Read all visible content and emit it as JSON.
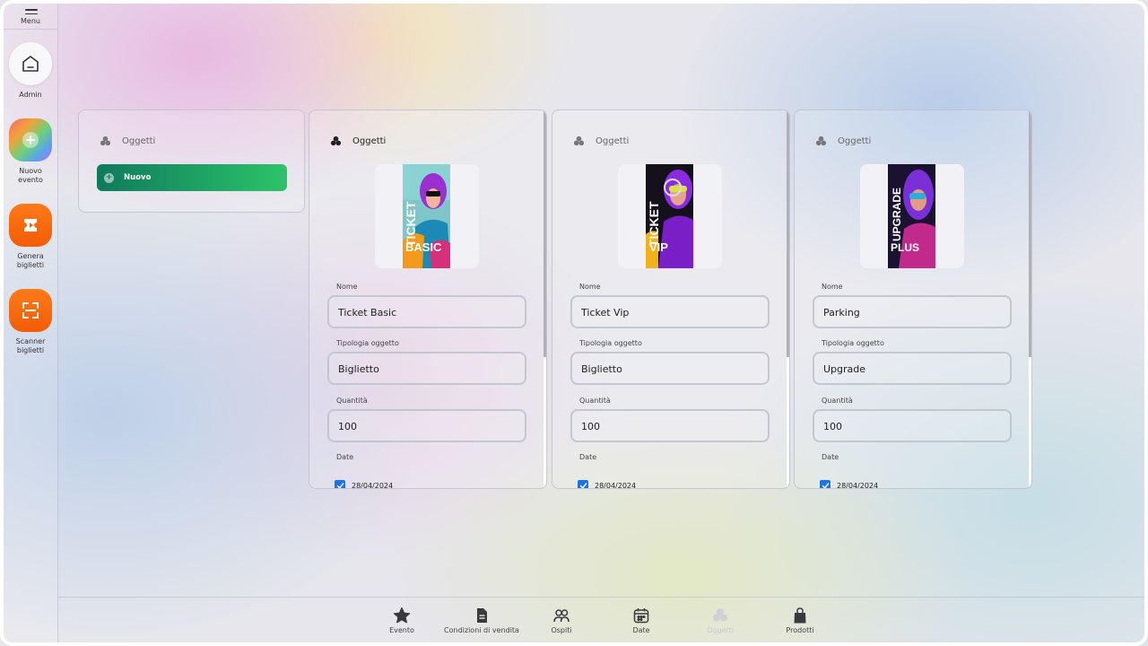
{
  "sidebar": {
    "menu_label": "Menu",
    "items": [
      {
        "label": "Admin",
        "icon": "home-icon"
      },
      {
        "label": "Nuovo evento",
        "icon": "plus-icon"
      },
      {
        "label": "Genera biglietti",
        "icon": "ticket-icon"
      },
      {
        "label": "Scanner biglietti",
        "icon": "scan-icon"
      }
    ]
  },
  "left_panel": {
    "title": "Oggetti",
    "new_button": "Nuovo"
  },
  "cards": [
    {
      "title": "Oggetti",
      "poster_line1": "TICKET",
      "poster_line2": "BASIC",
      "nome_label": "Nome",
      "nome": "Ticket Basic",
      "tipologia_label": "Tipologia oggetto",
      "tipologia": "Biglietto",
      "quantita_label": "Quantità",
      "quantita": "100",
      "date_label": "Date",
      "date": "28/04/2024",
      "date_checked": true
    },
    {
      "title": "Oggetti",
      "poster_line1": "TICKET",
      "poster_line2": "VIP",
      "nome_label": "Nome",
      "nome": "Ticket Vip",
      "tipologia_label": "Tipologia oggetto",
      "tipologia": "Biglietto",
      "quantita_label": "Quantità",
      "quantita": "100",
      "date_label": "Date",
      "date": "28/04/2024",
      "date_checked": true
    },
    {
      "title": "Oggetti",
      "poster_line1": "UPGRADE",
      "poster_line2": "PLUS",
      "nome_label": "Nome",
      "nome": "Parking",
      "tipologia_label": "Tipologia oggetto",
      "tipologia": "Upgrade",
      "quantita_label": "Quantità",
      "quantita": "100",
      "date_label": "Date",
      "date": "28/04/2024",
      "date_checked": true
    }
  ],
  "bottom_nav": [
    {
      "label": "Evento",
      "icon": "star-icon"
    },
    {
      "label": "Condizioni di vendita",
      "icon": "document-icon"
    },
    {
      "label": "Ospiti",
      "icon": "users-icon"
    },
    {
      "label": "Date",
      "icon": "calendar-icon"
    },
    {
      "label": "Oggetti",
      "icon": "clover-icon",
      "disabled": true
    },
    {
      "label": "Prodotti",
      "icon": "bag-icon"
    }
  ],
  "colors": {
    "accent_green_start": "#0f7a5c",
    "accent_green_end": "#2cc46a",
    "orange": "#f25c05",
    "checkbox_blue": "#1a73e8"
  }
}
